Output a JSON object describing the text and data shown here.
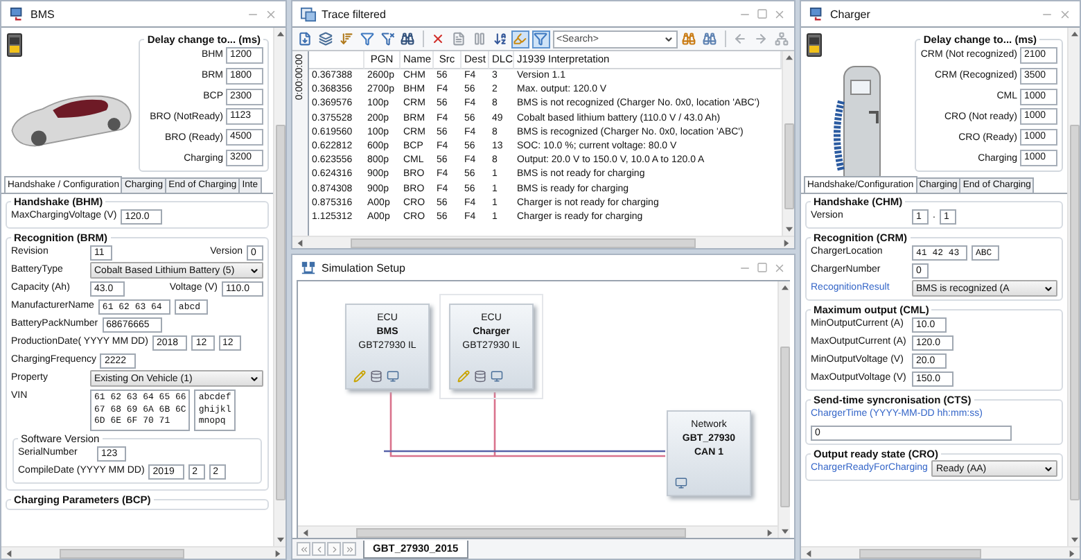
{
  "bms": {
    "title": "BMS",
    "delay_title": "Delay change to... (ms)",
    "delays": [
      {
        "label": "BHM",
        "value": "1200"
      },
      {
        "label": "BRM",
        "value": "1800"
      },
      {
        "label": "BCP",
        "value": "2300"
      },
      {
        "label": "BRO (NotReady)",
        "value": "1123"
      },
      {
        "label": "BRO (Ready)",
        "value": "4500"
      },
      {
        "label": "Charging",
        "value": "3200"
      }
    ],
    "tabs": [
      {
        "label": "Handshake / Configuration",
        "selected": true
      },
      {
        "label": "Charging",
        "selected": false
      },
      {
        "label": "End of Charging",
        "selected": false
      },
      {
        "label": "Inte",
        "selected": false
      }
    ],
    "groups": [
      {
        "title": "Handshake (BHM)",
        "rows": [
          {
            "kind": "row",
            "label": "MaxChargingVoltage (V)",
            "items": [
              {
                "kind": "input",
                "value": "120.0"
              }
            ]
          }
        ]
      },
      {
        "title": "Recognition (BRM)",
        "rows": [
          {
            "kind": "row",
            "label": "Revision",
            "items": [
              {
                "kind": "input",
                "value": "11"
              },
              {
                "kind": "label",
                "text": "Version"
              },
              {
                "kind": "input",
                "value": "0"
              }
            ]
          },
          {
            "kind": "row",
            "label": "BatteryType",
            "items": [
              {
                "kind": "select",
                "value": "Cobalt Based Lithium Battery (5)"
              }
            ]
          },
          {
            "kind": "row",
            "label": "Capacity (Ah)",
            "items": [
              {
                "kind": "input",
                "value": "43.0"
              },
              {
                "kind": "label",
                "text": "Voltage (V)"
              },
              {
                "kind": "input",
                "value": "110.0"
              }
            ]
          },
          {
            "kind": "row",
            "label": "ManufacturerName",
            "items": [
              {
                "kind": "mono",
                "value": "61 62 63 64"
              },
              {
                "kind": "mono",
                "value": "abcd"
              }
            ]
          },
          {
            "kind": "row",
            "label": "BatteryPackNumber",
            "items": [
              {
                "kind": "input",
                "value": "68676665"
              }
            ]
          },
          {
            "kind": "row",
            "label": "ProductionDate( YYYY MM DD)",
            "items": [
              {
                "kind": "input",
                "value": "2018"
              },
              {
                "kind": "input",
                "value": "12"
              },
              {
                "kind": "input",
                "value": "12"
              }
            ]
          },
          {
            "kind": "row",
            "label": "ChargingFrequency",
            "items": [
              {
                "kind": "input",
                "value": "2222"
              }
            ]
          },
          {
            "kind": "row",
            "label": "Property",
            "items": [
              {
                "kind": "select",
                "value": "Existing On Vehicle (1)"
              }
            ]
          },
          {
            "kind": "row",
            "label": "VIN",
            "items": [
              {
                "kind": "textarea",
                "lines": [
                  "61 62 63 64 65 66",
                  "67 68 69 6A 6B 6C",
                  "6D 6E 6F 70 71"
                ]
              },
              {
                "kind": "textarea",
                "lines": [
                  "abcdef",
                  "ghijkl",
                  "mnopq"
                ]
              }
            ]
          },
          {
            "kind": "group",
            "title": "Software Version",
            "rows": [
              {
                "kind": "row",
                "label": "SerialNumber",
                "items": [
                  {
                    "kind": "input",
                    "value": "123"
                  }
                ]
              },
              {
                "kind": "row",
                "label": "CompileDate (YYYY MM DD)",
                "items": [
                  {
                    "kind": "input",
                    "value": "2019"
                  },
                  {
                    "kind": "input",
                    "value": "2"
                  },
                  {
                    "kind": "input",
                    "value": "2"
                  }
                ]
              }
            ]
          }
        ]
      },
      {
        "title": "Charging Parameters (BCP)"
      }
    ]
  },
  "trace": {
    "title": "Trace filtered",
    "toolbar": [
      {
        "kind": "filter-in",
        "pressed": false
      },
      {
        "kind": "layers",
        "pressed": false
      },
      {
        "kind": "sort",
        "pressed": false
      },
      {
        "kind": "filter",
        "pressed": false
      },
      {
        "kind": "filter-x",
        "pressed": false
      },
      {
        "kind": "binoculars",
        "pressed": false
      },
      {
        "kind": "separator"
      },
      {
        "kind": "delete",
        "pressed": false
      },
      {
        "kind": "document",
        "pressed": false
      },
      {
        "kind": "pause",
        "pressed": false
      },
      {
        "kind": "text-sort",
        "pressed": false
      },
      {
        "kind": "highlight",
        "pressed": true
      },
      {
        "kind": "filter",
        "pressed": true
      },
      {
        "kind": "search",
        "placeholder": "<Search>"
      },
      {
        "kind": "find-prev",
        "pressed": false
      },
      {
        "kind": "find-next",
        "pressed": false
      },
      {
        "kind": "separator"
      },
      {
        "kind": "back",
        "pressed": false
      },
      {
        "kind": "forward",
        "pressed": false
      },
      {
        "kind": "bus",
        "pressed": false
      }
    ],
    "time_label": "0:00:00:00",
    "columns": [
      "PGN",
      "Name",
      "Src",
      "Dest",
      "DLC",
      "J1939 Interpretation"
    ],
    "rows": [
      {
        "time": "0.367388",
        "pgn": "2600p",
        "name": "CHM",
        "src": "56",
        "dest": "F4",
        "dlc": "3",
        "text": "Version 1.1"
      },
      {
        "time": "0.368356",
        "pgn": "2700p",
        "name": "BHM",
        "src": "F4",
        "dest": "56",
        "dlc": "2",
        "text": "Max. output: 120.0 V"
      },
      {
        "time": "0.369576",
        "pgn": "100p",
        "name": "CRM",
        "src": "56",
        "dest": "F4",
        "dlc": "8",
        "text": "BMS is not recognized (Charger No. 0x0, location 'ABC')"
      },
      {
        "time": "0.375528",
        "pgn": "200p",
        "name": "BRM",
        "src": "F4",
        "dest": "56",
        "dlc": "49",
        "text": "Cobalt based lithium battery (110.0 V /  43.0  Ah)"
      },
      {
        "time": "0.619560",
        "pgn": "100p",
        "name": "CRM",
        "src": "56",
        "dest": "F4",
        "dlc": "8",
        "text": "BMS is recognized (Charger No. 0x0, location 'ABC')"
      },
      {
        "time": "0.622812",
        "pgn": "600p",
        "name": "BCP",
        "src": "F4",
        "dest": "56",
        "dlc": "13",
        "text": "SOC: 10.0 %; current voltage:  80.0 V"
      },
      {
        "time": "0.623556",
        "pgn": "800p",
        "name": "CML",
        "src": "56",
        "dest": "F4",
        "dlc": "8",
        "text": "Output:  20.0 V to 150.0 V,  10.0 A to 120.0 A"
      },
      {
        "time": "0.624316",
        "pgn": "900p",
        "name": "BRO",
        "src": "F4",
        "dest": "56",
        "dlc": "1",
        "text": "BMS is not ready for charging"
      },
      {
        "time": "0.874308",
        "pgn": "900p",
        "name": "BRO",
        "src": "F4",
        "dest": "56",
        "dlc": "1",
        "text": "BMS is ready for charging"
      },
      {
        "time": "0.875316",
        "pgn": "A00p",
        "name": "CRO",
        "src": "56",
        "dest": "F4",
        "dlc": "1",
        "text": "Charger is not ready for charging"
      },
      {
        "time": "1.125312",
        "pgn": "A00p",
        "name": "CRO",
        "src": "56",
        "dest": "F4",
        "dlc": "1",
        "text": "Charger is ready for charging"
      }
    ]
  },
  "simulation": {
    "title": "Simulation Setup",
    "nodes": [
      {
        "kind": "ecu",
        "type": "ECU",
        "name": "BMS",
        "sub": "GBT27930 IL",
        "selected": false
      },
      {
        "kind": "ecu",
        "type": "ECU",
        "name": "Charger",
        "sub": "GBT27930 IL",
        "selected": true
      },
      {
        "kind": "network",
        "type": "Network",
        "name": "GBT_27930",
        "sub": "CAN 1",
        "selected": false
      }
    ],
    "tabs": [
      {
        "label": "GBT_27930_2015",
        "selected": true
      }
    ]
  },
  "charger": {
    "title": "Charger",
    "delay_title": "Delay change to... (ms)",
    "delays": [
      {
        "label": "CRM (Not recognized)",
        "value": "2100"
      },
      {
        "label": "CRM (Recognized)",
        "value": "3500"
      },
      {
        "label": "CML",
        "value": "1000"
      },
      {
        "label": "CRO (Not ready)",
        "value": "1000"
      },
      {
        "label": "CRO (Ready)",
        "value": "1000"
      },
      {
        "label": "Charging",
        "value": "1000"
      }
    ],
    "tabs": [
      {
        "label": "Handshake/Configuration",
        "selected": true
      },
      {
        "label": "Charging",
        "selected": false
      },
      {
        "label": "End of Charging",
        "selected": false
      }
    ],
    "groups": [
      {
        "title": "Handshake (CHM)",
        "rows": [
          {
            "kind": "row",
            "label": "Version",
            "items": [
              {
                "kind": "input",
                "value": "1"
              },
              {
                "kind": "sep",
                "text": "."
              },
              {
                "kind": "input",
                "value": "1"
              }
            ]
          }
        ]
      },
      {
        "title": "Recognition (CRM)",
        "rows": [
          {
            "kind": "row",
            "label": "ChargerLocation",
            "items": [
              {
                "kind": "mono",
                "value": "41 42 43"
              },
              {
                "kind": "mono",
                "value": "ABC"
              }
            ]
          },
          {
            "kind": "row",
            "label": "ChargerNumber",
            "items": [
              {
                "kind": "input",
                "value": "0"
              }
            ]
          },
          {
            "kind": "link-row",
            "label": "RecognitionResult",
            "items": [
              {
                "kind": "select",
                "value": "BMS is recognized (A"
              }
            ]
          }
        ]
      },
      {
        "title": "Maximum output (CML)",
        "rows": [
          {
            "kind": "row",
            "label": "MinOutputCurrent (A)",
            "items": [
              {
                "kind": "input",
                "value": "10.0"
              }
            ]
          },
          {
            "kind": "row",
            "label": "MaxOutputCurrent (A)",
            "items": [
              {
                "kind": "input",
                "value": "120.0"
              }
            ]
          },
          {
            "kind": "row",
            "label": "MinOutputVoltage (V)",
            "items": [
              {
                "kind": "input",
                "value": "20.0"
              }
            ]
          },
          {
            "kind": "row",
            "label": "MaxOutputVoltage (V)",
            "items": [
              {
                "kind": "input",
                "value": "150.0"
              }
            ]
          }
        ]
      },
      {
        "title": "Send-time syncronisation (CTS)",
        "rows": [
          {
            "kind": "link-row",
            "label": "ChargerTime (YYYY-MM-DD hh:mm:ss)"
          },
          {
            "kind": "wide-row",
            "items": [
              {
                "kind": "input",
                "value": "0"
              }
            ]
          }
        ]
      },
      {
        "title": "Output ready state (CRO)",
        "rows": [
          {
            "kind": "link-row",
            "label": "ChargerReadyForCharging",
            "items": [
              {
                "kind": "select",
                "value": "Ready (AA)"
              }
            ]
          }
        ]
      }
    ]
  }
}
